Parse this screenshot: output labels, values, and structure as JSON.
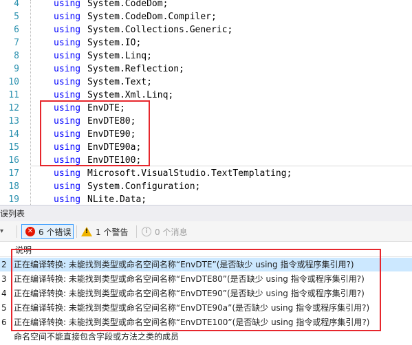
{
  "editor": {
    "lines": [
      {
        "num": "4",
        "keyword": "using",
        "ns": "System.CodeDom;"
      },
      {
        "num": "5",
        "keyword": "using",
        "ns": "System.CodeDom.Compiler;"
      },
      {
        "num": "6",
        "keyword": "using",
        "ns": "System.Collections.Generic;"
      },
      {
        "num": "7",
        "keyword": "using",
        "ns": "System.IO;"
      },
      {
        "num": "8",
        "keyword": "using",
        "ns": "System.Linq;"
      },
      {
        "num": "9",
        "keyword": "using",
        "ns": "System.Reflection;"
      },
      {
        "num": "10",
        "keyword": "using",
        "ns": "System.Text;"
      },
      {
        "num": "11",
        "keyword": "using",
        "ns": "System.Xml.Linq;"
      },
      {
        "num": "12",
        "keyword": "using",
        "ns": "EnvDTE;"
      },
      {
        "num": "13",
        "keyword": "using",
        "ns": "EnvDTE80;"
      },
      {
        "num": "14",
        "keyword": "using",
        "ns": "EnvDTE90;"
      },
      {
        "num": "15",
        "keyword": "using",
        "ns": "EnvDTE90a;"
      },
      {
        "num": "16",
        "keyword": "using",
        "ns": "EnvDTE100;"
      },
      {
        "num": "17",
        "keyword": "using",
        "ns": "Microsoft.VisualStudio.TextTemplating;"
      },
      {
        "num": "18",
        "keyword": "using",
        "ns": "System.Configuration;"
      },
      {
        "num": "19",
        "keyword": "using",
        "ns": "NLite.Data;"
      }
    ]
  },
  "error_list": {
    "title": "误列表",
    "filters": {
      "errors_label": "6 个错误",
      "warnings_label": "1 个警告",
      "messages_label": "0 个消息"
    },
    "columns": {
      "description": "说明"
    },
    "rows": [
      {
        "num": "2",
        "text": "正在编译转换: 未能找到类型或命名空间名称“EnvDTE”(是否缺少 using 指令或程序集引用?)"
      },
      {
        "num": "3",
        "text": "正在编译转换: 未能找到类型或命名空间名称“EnvDTE80”(是否缺少 using 指令或程序集引用?)"
      },
      {
        "num": "4",
        "text": "正在编译转换: 未能找到类型或命名空间名称“EnvDTE90”(是否缺少 using 指令或程序集引用?)"
      },
      {
        "num": "5",
        "text": "正在编译转换: 未能找到类型或命名空间名称“EnvDTE90a”(是否缺少 using 指令或程序集引用?)"
      },
      {
        "num": "6",
        "text": "正在编译转换: 未能找到类型或命名空间名称“EnvDTE100”(是否缺少 using 指令或程序集引用?)"
      },
      {
        "num": "",
        "text": "命名空间不能直接包含字段或方法之类的成员"
      }
    ]
  },
  "colors": {
    "keyword": "#0000ff",
    "line_number": "#2b91af",
    "highlight_box": "#e6262c",
    "selected_row": "#cce8ff"
  }
}
